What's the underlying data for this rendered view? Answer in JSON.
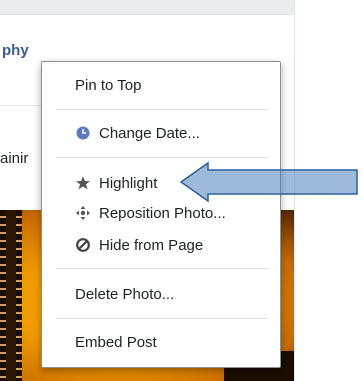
{
  "post": {
    "page_name": "phy",
    "caption_fragment": "ainir"
  },
  "menu": {
    "items": [
      {
        "label": "Pin to Top"
      },
      {
        "label": "Change Date...",
        "icon": "clock-icon"
      },
      {
        "label": "Highlight",
        "icon": "star-icon"
      },
      {
        "label": "Reposition Photo...",
        "icon": "move-arrows-icon"
      },
      {
        "label": "Hide from Page",
        "icon": "prohibited-icon"
      },
      {
        "label": "Delete Photo..."
      },
      {
        "label": "Embed Post"
      }
    ]
  },
  "colors": {
    "link_blue": "#3b5998",
    "clock_blue": "#5b7bc0",
    "annotation_arrow": "#4f81bd"
  }
}
